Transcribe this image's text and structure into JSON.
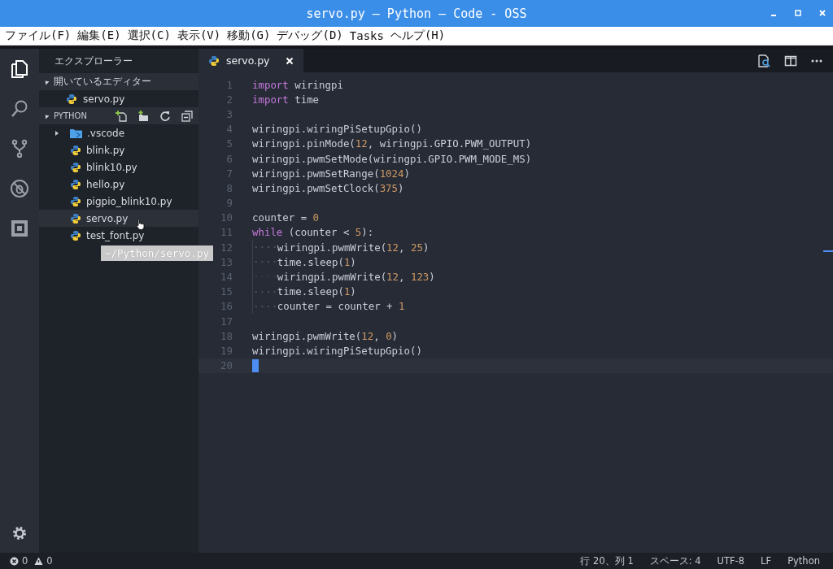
{
  "window": {
    "title": "servo.py — Python — Code - OSS"
  },
  "menu": [
    "ファイル(F)",
    "編集(E)",
    "選択(C)",
    "表示(V)",
    "移動(G)",
    "デバッグ(D)",
    "Tasks",
    "ヘルプ(H)"
  ],
  "activity_bar": [
    {
      "kind": "files",
      "selected": true
    },
    {
      "kind": "search",
      "selected": false
    },
    {
      "kind": "scm",
      "selected": false
    },
    {
      "kind": "debug",
      "selected": false
    },
    {
      "kind": "extensions",
      "selected": false
    }
  ],
  "sidebar": {
    "title": "エクスプローラー",
    "open_editors": {
      "label": "開いているエディター",
      "expanded": true,
      "items": [
        {
          "name": "servo.py",
          "kind": "python"
        }
      ]
    },
    "folder": {
      "label": "PYTHON",
      "expanded": true,
      "items": [
        {
          "name": ".vscode",
          "kind": "folder",
          "expanded": false,
          "selected": false
        },
        {
          "name": "blink.py",
          "kind": "python",
          "selected": false
        },
        {
          "name": "blink10.py",
          "kind": "python",
          "selected": false
        },
        {
          "name": "hello.py",
          "kind": "python",
          "selected": false
        },
        {
          "name": "pigpio_blink10.py",
          "kind": "python",
          "selected": false
        },
        {
          "name": "servo.py",
          "kind": "python",
          "selected": true
        },
        {
          "name": "test_font.py",
          "kind": "python",
          "selected": false
        }
      ]
    }
  },
  "tooltip": "~/Python/servo.py",
  "tabs": [
    {
      "label": "servo.py",
      "selected": true
    }
  ],
  "editor": {
    "lines": [
      {
        "n": "1",
        "indented": false,
        "tokens": [
          {
            "t": "import",
            "kind": "keyword"
          },
          {
            "t": " wiringpi",
            "kind": "name"
          }
        ]
      },
      {
        "n": "2",
        "indented": false,
        "tokens": [
          {
            "t": "import",
            "kind": "keyword"
          },
          {
            "t": " time",
            "kind": "name"
          }
        ]
      },
      {
        "n": "3",
        "indented": false
      },
      {
        "n": "4",
        "indented": false,
        "tokens": [
          {
            "t": "wiringpi.wiringPiSetupGpio()",
            "kind": "name"
          }
        ]
      },
      {
        "n": "5",
        "indented": false,
        "tokens": [
          {
            "t": "wiringpi.pinMode(",
            "kind": "name"
          },
          {
            "t": "12",
            "kind": "number"
          },
          {
            "t": ", wiringpi.GPIO.PWM_OUTPUT)",
            "kind": "name"
          }
        ]
      },
      {
        "n": "6",
        "indented": false,
        "tokens": [
          {
            "t": "wiringpi.pwmSetMode(wiringpi.GPIO.PWM_MODE_MS)",
            "kind": "name"
          }
        ]
      },
      {
        "n": "7",
        "indented": false,
        "tokens": [
          {
            "t": "wiringpi.pwmSetRange(",
            "kind": "name"
          },
          {
            "t": "1024",
            "kind": "number"
          },
          {
            "t": ")",
            "kind": "name"
          }
        ]
      },
      {
        "n": "8",
        "indented": false,
        "tokens": [
          {
            "t": "wiringpi.pwmSetClock(",
            "kind": "name"
          },
          {
            "t": "375",
            "kind": "number"
          },
          {
            "t": ")",
            "kind": "name"
          }
        ]
      },
      {
        "n": "9",
        "indented": false
      },
      {
        "n": "10",
        "indented": false,
        "tokens": [
          {
            "t": "counter = ",
            "kind": "name"
          },
          {
            "t": "0",
            "kind": "number"
          }
        ]
      },
      {
        "n": "11",
        "indented": false,
        "tokens": [
          {
            "t": "while",
            "kind": "keyword"
          },
          {
            "t": " (counter < ",
            "kind": "name"
          },
          {
            "t": "5",
            "kind": "number"
          },
          {
            "t": "):",
            "kind": "name"
          }
        ]
      },
      {
        "n": "12",
        "indented": true,
        "tokens": [
          {
            "t": "wiringpi.pwmWrite(",
            "kind": "name"
          },
          {
            "t": "12",
            "kind": "number"
          },
          {
            "t": ", ",
            "kind": "name"
          },
          {
            "t": "25",
            "kind": "number"
          },
          {
            "t": ")",
            "kind": "name"
          }
        ]
      },
      {
        "n": "13",
        "indented": true,
        "tokens": [
          {
            "t": "time.sleep(",
            "kind": "name"
          },
          {
            "t": "1",
            "kind": "number"
          },
          {
            "t": ")",
            "kind": "name"
          }
        ]
      },
      {
        "n": "14",
        "indented": true,
        "tokens": [
          {
            "t": "wiringpi.pwmWrite(",
            "kind": "name"
          },
          {
            "t": "12",
            "kind": "number"
          },
          {
            "t": ", ",
            "kind": "name"
          },
          {
            "t": "123",
            "kind": "number"
          },
          {
            "t": ")",
            "kind": "name"
          }
        ]
      },
      {
        "n": "15",
        "indented": true,
        "tokens": [
          {
            "t": "time.sleep(",
            "kind": "name"
          },
          {
            "t": "1",
            "kind": "number"
          },
          {
            "t": ")",
            "kind": "name"
          }
        ]
      },
      {
        "n": "16",
        "indented": true,
        "tokens": [
          {
            "t": "counter = counter + ",
            "kind": "name"
          },
          {
            "t": "1",
            "kind": "number"
          }
        ]
      },
      {
        "n": "17",
        "indented": false
      },
      {
        "n": "18",
        "indented": false,
        "tokens": [
          {
            "t": "wiringpi.pwmWrite(",
            "kind": "name"
          },
          {
            "t": "12",
            "kind": "number"
          },
          {
            "t": ", ",
            "kind": "name"
          },
          {
            "t": "0",
            "kind": "number"
          },
          {
            "t": ")",
            "kind": "name"
          }
        ]
      },
      {
        "n": "19",
        "indented": false,
        "tokens": [
          {
            "t": "wiringpi.wiringPiSetupGpio()",
            "kind": "name"
          }
        ]
      },
      {
        "n": "20",
        "indented": false,
        "current": true
      }
    ]
  },
  "status_bar": {
    "errors": "0",
    "warnings": "0",
    "items": [
      "行 20、列 1",
      "スペース: 4",
      "UTF-8",
      "LF",
      "Python"
    ]
  }
}
